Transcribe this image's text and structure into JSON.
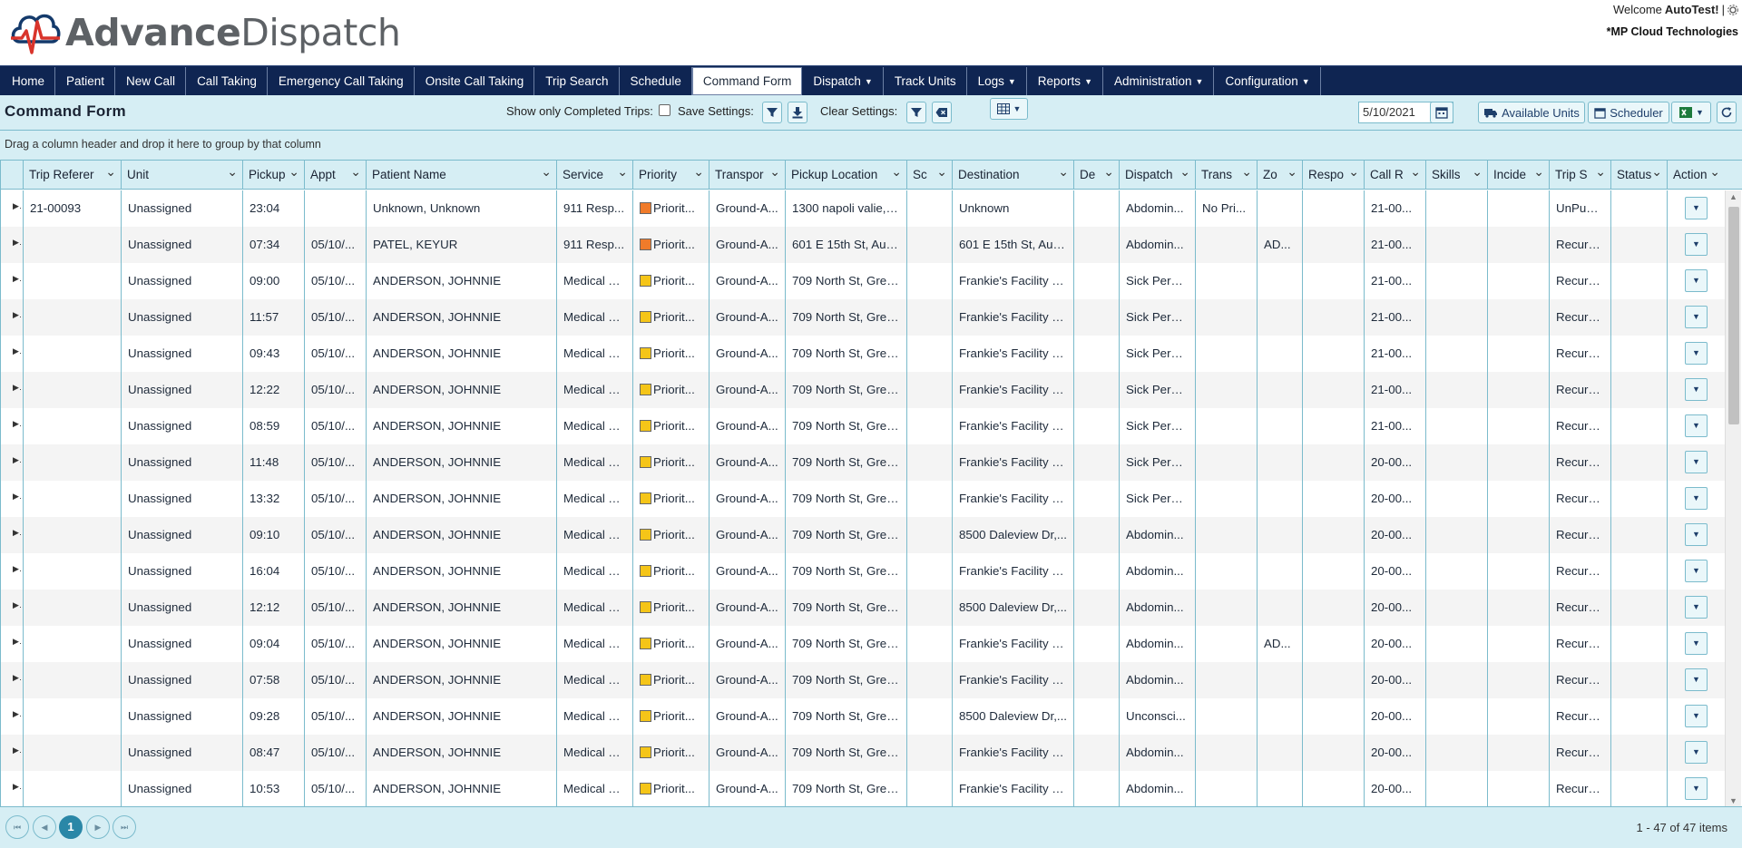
{
  "app": {
    "logo_adv": "Advance",
    "logo_dis": "Dispatch",
    "welcome_prefix": "Welcome",
    "user": "AutoTest!",
    "company": "*MP Cloud Technologies"
  },
  "nav": [
    "Home",
    "Patient",
    "New Call",
    "Call Taking",
    "Emergency Call Taking",
    "Onsite Call Taking",
    "Trip Search",
    "Schedule",
    "Command Form",
    "Dispatch",
    "Track Units",
    "Logs",
    "Reports",
    "Administration",
    "Configuration"
  ],
  "nav_dropdowns": [
    "Dispatch",
    "Logs",
    "Reports",
    "Administration",
    "Configuration"
  ],
  "nav_active": "Command Form",
  "toolbar": {
    "title": "Command Form",
    "show_completed_label": "Show only Completed Trips:",
    "save_settings_label": "Save Settings:",
    "clear_settings_label": "Clear Settings:",
    "date": "5/10/2021",
    "available_units": "Available Units",
    "scheduler": "Scheduler"
  },
  "groupbar_text": "Drag a column header and drop it here to group by that column",
  "columns": [
    "Trip Referer",
    "Unit",
    "Pickup",
    "Appt",
    "Patient Name",
    "Service",
    "Priority",
    "Transpor",
    "Pickup Location",
    "Sc",
    "Destination",
    "De",
    "Dispatch",
    "Trans",
    "Zo",
    "Respo",
    "Call R",
    "Skills",
    "Incide",
    "Trip S",
    "Status",
    "Action"
  ],
  "rows": [
    {
      "ref": "21-00093",
      "unit": "Unassigned",
      "pickup": "23:04",
      "appt": "",
      "patient": "Unknown, Unknown",
      "service": "911 Resp...",
      "priority": "Priorit...",
      "prio_color": "#f07b2a",
      "transport": "Ground-A...",
      "location": "1300 napoli valie,s...",
      "destination": "Unknown",
      "dispatch": "Abdomin...",
      "trans": "No Pri...",
      "zone": "",
      "call": "21-00...",
      "trip": "UnPublish"
    },
    {
      "ref": "",
      "unit": "Unassigned",
      "pickup": "07:34",
      "appt": "05/10/...",
      "patient": "PATEL, KEYUR",
      "service": "911 Resp...",
      "priority": "Priorit...",
      "prio_color": "#f07b2a",
      "transport": "Ground-A...",
      "location": "601 E 15th St, Aus...",
      "destination": "601 E 15th St, Aus...",
      "dispatch": "Abdomin...",
      "trans": "",
      "zone": "AD...",
      "call": "21-00...",
      "trip": "Recurring"
    },
    {
      "ref": "",
      "unit": "Unassigned",
      "pickup": "09:00",
      "appt": "05/10/...",
      "patient": "ANDERSON, JOHNNIE",
      "service": "Medical Tr...",
      "priority": "Priorit...",
      "prio_color": "#f5c518",
      "transport": "Ground-A...",
      "location": "709 North St, Gree...",
      "destination": "Frankie's Facility F...",
      "dispatch": "Sick Person",
      "trans": "",
      "zone": "",
      "call": "21-00...",
      "trip": "Recurring"
    },
    {
      "ref": "",
      "unit": "Unassigned",
      "pickup": "11:57",
      "appt": "05/10/...",
      "patient": "ANDERSON, JOHNNIE",
      "service": "Medical Tr...",
      "priority": "Priorit...",
      "prio_color": "#f5c518",
      "transport": "Ground-A...",
      "location": "709 North St, Gree...",
      "destination": "Frankie's Facility F...",
      "dispatch": "Sick Person",
      "trans": "",
      "zone": "",
      "call": "21-00...",
      "trip": "Recurring"
    },
    {
      "ref": "",
      "unit": "Unassigned",
      "pickup": "09:43",
      "appt": "05/10/...",
      "patient": "ANDERSON, JOHNNIE",
      "service": "Medical Tr...",
      "priority": "Priorit...",
      "prio_color": "#f5c518",
      "transport": "Ground-A...",
      "location": "709 North St, Gree...",
      "destination": "Frankie's Facility F...",
      "dispatch": "Sick Person",
      "trans": "",
      "zone": "",
      "call": "21-00...",
      "trip": "Recurring"
    },
    {
      "ref": "",
      "unit": "Unassigned",
      "pickup": "12:22",
      "appt": "05/10/...",
      "patient": "ANDERSON, JOHNNIE",
      "service": "Medical Tr...",
      "priority": "Priorit...",
      "prio_color": "#f5c518",
      "transport": "Ground-A...",
      "location": "709 North St, Gree...",
      "destination": "Frankie's Facility F...",
      "dispatch": "Sick Person",
      "trans": "",
      "zone": "",
      "call": "21-00...",
      "trip": "Recurring"
    },
    {
      "ref": "",
      "unit": "Unassigned",
      "pickup": "08:59",
      "appt": "05/10/...",
      "patient": "ANDERSON, JOHNNIE",
      "service": "Medical Tr...",
      "priority": "Priorit...",
      "prio_color": "#f5c518",
      "transport": "Ground-A...",
      "location": "709 North St, Gree...",
      "destination": "Frankie's Facility F...",
      "dispatch": "Sick Person",
      "trans": "",
      "zone": "",
      "call": "21-00...",
      "trip": "Recurring"
    },
    {
      "ref": "",
      "unit": "Unassigned",
      "pickup": "11:48",
      "appt": "05/10/...",
      "patient": "ANDERSON, JOHNNIE",
      "service": "Medical Tr...",
      "priority": "Priorit...",
      "prio_color": "#f5c518",
      "transport": "Ground-A...",
      "location": "709 North St, Gree...",
      "destination": "Frankie's Facility F...",
      "dispatch": "Sick Person",
      "trans": "",
      "zone": "",
      "call": "20-00...",
      "trip": "Recurring"
    },
    {
      "ref": "",
      "unit": "Unassigned",
      "pickup": "13:32",
      "appt": "05/10/...",
      "patient": "ANDERSON, JOHNNIE",
      "service": "Medical Tr...",
      "priority": "Priorit...",
      "prio_color": "#f5c518",
      "transport": "Ground-A...",
      "location": "709 North St, Gree...",
      "destination": "Frankie's Facility F...",
      "dispatch": "Sick Person",
      "trans": "",
      "zone": "",
      "call": "20-00...",
      "trip": "Recurring"
    },
    {
      "ref": "",
      "unit": "Unassigned",
      "pickup": "09:10",
      "appt": "05/10/...",
      "patient": "ANDERSON, JOHNNIE",
      "service": "Medical Tr...",
      "priority": "Priorit...",
      "prio_color": "#f5c518",
      "transport": "Ground-A...",
      "location": "709 North St, Gree...",
      "destination": "8500 Daleview Dr,...",
      "dispatch": "Abdomin...",
      "trans": "",
      "zone": "",
      "call": "20-00...",
      "trip": "Recurring"
    },
    {
      "ref": "",
      "unit": "Unassigned",
      "pickup": "16:04",
      "appt": "05/10/...",
      "patient": "ANDERSON, JOHNNIE",
      "service": "Medical Tr...",
      "priority": "Priorit...",
      "prio_color": "#f5c518",
      "transport": "Ground-A...",
      "location": "709 North St, Gree...",
      "destination": "Frankie's Facility F...",
      "dispatch": "Abdomin...",
      "trans": "",
      "zone": "",
      "call": "20-00...",
      "trip": "Recurring"
    },
    {
      "ref": "",
      "unit": "Unassigned",
      "pickup": "12:12",
      "appt": "05/10/...",
      "patient": "ANDERSON, JOHNNIE",
      "service": "Medical Tr...",
      "priority": "Priorit...",
      "prio_color": "#f5c518",
      "transport": "Ground-A...",
      "location": "709 North St, Gree...",
      "destination": "8500 Daleview Dr,...",
      "dispatch": "Abdomin...",
      "trans": "",
      "zone": "",
      "call": "20-00...",
      "trip": "Recurring"
    },
    {
      "ref": "",
      "unit": "Unassigned",
      "pickup": "09:04",
      "appt": "05/10/...",
      "patient": "ANDERSON, JOHNNIE",
      "service": "Medical Tr...",
      "priority": "Priorit...",
      "prio_color": "#f5c518",
      "transport": "Ground-A...",
      "location": "709 North St, Gree...",
      "destination": "Frankie's Facility F...",
      "dispatch": "Abdomin...",
      "trans": "",
      "zone": "AD...",
      "call": "20-00...",
      "trip": "Recurring"
    },
    {
      "ref": "",
      "unit": "Unassigned",
      "pickup": "07:58",
      "appt": "05/10/...",
      "patient": "ANDERSON, JOHNNIE",
      "service": "Medical Tr...",
      "priority": "Priorit...",
      "prio_color": "#f5c518",
      "transport": "Ground-A...",
      "location": "709 North St, Gree...",
      "destination": "Frankie's Facility F...",
      "dispatch": "Abdomin...",
      "trans": "",
      "zone": "",
      "call": "20-00...",
      "trip": "Recurring"
    },
    {
      "ref": "",
      "unit": "Unassigned",
      "pickup": "09:28",
      "appt": "05/10/...",
      "patient": "ANDERSON, JOHNNIE",
      "service": "Medical Tr...",
      "priority": "Priorit...",
      "prio_color": "#f5c518",
      "transport": "Ground-A...",
      "location": "709 North St, Gree...",
      "destination": "8500 Daleview Dr,...",
      "dispatch": "Unconsci...",
      "trans": "",
      "zone": "",
      "call": "20-00...",
      "trip": "Recurring"
    },
    {
      "ref": "",
      "unit": "Unassigned",
      "pickup": "08:47",
      "appt": "05/10/...",
      "patient": "ANDERSON, JOHNNIE",
      "service": "Medical Tr...",
      "priority": "Priorit...",
      "prio_color": "#f5c518",
      "transport": "Ground-A...",
      "location": "709 North St, Gree...",
      "destination": "Frankie's Facility F...",
      "dispatch": "Abdomin...",
      "trans": "",
      "zone": "",
      "call": "20-00...",
      "trip": "Recurring"
    },
    {
      "ref": "",
      "unit": "Unassigned",
      "pickup": "10:53",
      "appt": "05/10/...",
      "patient": "ANDERSON, JOHNNIE",
      "service": "Medical Tr...",
      "priority": "Priorit...",
      "prio_color": "#f5c518",
      "transport": "Ground-A...",
      "location": "709 North St, Gree...",
      "destination": "Frankie's Facility F...",
      "dispatch": "Abdomin...",
      "trans": "",
      "zone": "",
      "call": "20-00...",
      "trip": "Recurring"
    }
  ],
  "pager": {
    "current": "1",
    "info": "1 - 47 of 47 items"
  },
  "colors": {
    "nav_bg": "#0f2552",
    "panel_bg": "#d6eef4",
    "border": "#7bbbcc",
    "accent": "#2a87a7",
    "priority_orange": "#f07b2a",
    "priority_yellow": "#f5c518"
  }
}
